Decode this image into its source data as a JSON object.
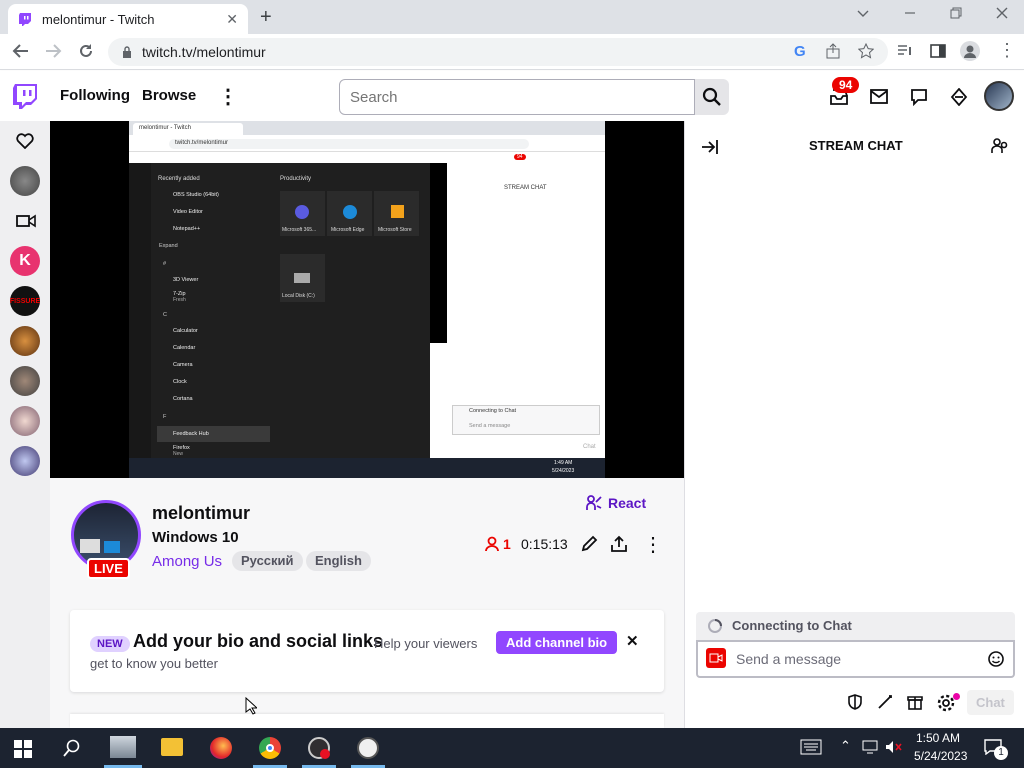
{
  "browser": {
    "tab_title": "melontimur - Twitch",
    "url": "twitch.tv/melontimur",
    "new_tab": "+",
    "tab_close": "✕"
  },
  "twitch": {
    "nav": {
      "following": "Following",
      "browse": "Browse",
      "more": "⋮"
    },
    "search": {
      "placeholder": "Search"
    },
    "notifications_badge": "94"
  },
  "channel": {
    "name": "melontimur",
    "title": "Windows 10",
    "category": "Among Us",
    "tags": [
      "Русский",
      "English"
    ],
    "live": "LIVE",
    "viewers": "1",
    "uptime": "0:15:13",
    "react": "React"
  },
  "bio_card": {
    "new_badge": "NEW",
    "heading": "Add your bio and social links",
    "sub": "Help your viewers",
    "sub2": "get to know you better",
    "button": "Add channel bio",
    "close": "✕"
  },
  "chat": {
    "title": "STREAM CHAT",
    "connecting": "Connecting to Chat",
    "placeholder": "Send a message",
    "send": "Chat"
  },
  "stream_screen": {
    "tab": "melontimur - Twitch",
    "url": "twitch.tv/melontimur",
    "recently_added": "Recently added",
    "productivity": "Productivity",
    "apps": [
      "OBS Studio (64bit)",
      "Video Editor",
      "Notepad++"
    ],
    "expand": "Expand",
    "letters": [
      "#",
      "C",
      "F"
    ],
    "apps2": [
      "3D Viewer",
      "7-Zip",
      "Calculator",
      "Calendar",
      "Camera",
      "Clock",
      "Cortana",
      "Feedback Hub",
      "Firefox"
    ],
    "sub_7zip": "Fresh",
    "sub_firefox": "New",
    "tiles": [
      "Microsoft 365...",
      "Microsoft Edge",
      "Microsoft Store",
      "Local Disk (C:)"
    ],
    "chat_title": "STREAM CHAT",
    "connecting": "Connecting to Chat",
    "send_msg": "Send a message",
    "chat_btn": "Chat",
    "badge": "94",
    "time": "1:49 AM",
    "date": "5/24/2023"
  },
  "taskbar": {
    "time": "1:50 AM",
    "date": "5/24/2023",
    "notif_count": "1"
  },
  "colors": {
    "twitch_purple": "#9147ff",
    "live_red": "#eb0400",
    "taskbar": "#1c2330"
  }
}
